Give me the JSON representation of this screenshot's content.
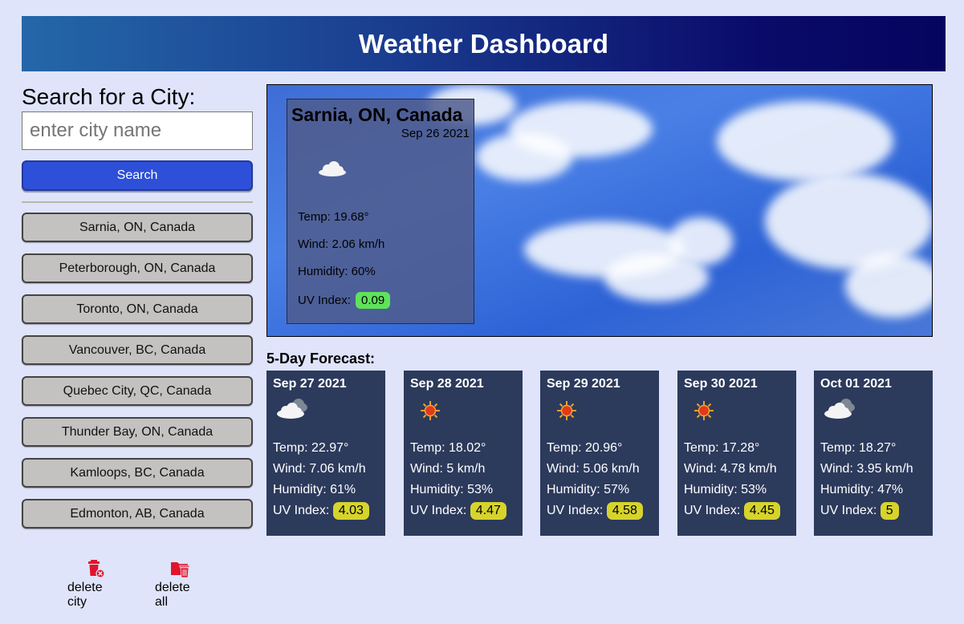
{
  "header": {
    "title": "Weather Dashboard"
  },
  "search": {
    "label": "Search for a City:",
    "placeholder": "enter city name",
    "button_label": "Search"
  },
  "history": [
    "Sarnia, ON, Canada",
    "Peterborough, ON, Canada",
    "Toronto, ON, Canada",
    "Vancouver, BC, Canada",
    "Quebec City, QC, Canada",
    "Thunder Bay, ON, Canada",
    "Kamloops, BC, Canada",
    "Edmonton, AB, Canada"
  ],
  "actions": {
    "delete_city": "delete city",
    "delete_all": "delete all"
  },
  "current": {
    "city": "Sarnia, ON, Canada",
    "date": "Sep 26 2021",
    "icon": "cloud-icon",
    "temp": "Temp: 19.68°",
    "wind": "Wind: 2.06 km/h",
    "humidity": "Humidity: 60%",
    "uv_label": "UV Index:",
    "uv_value": "0.09",
    "uv_color": "#5ee35a"
  },
  "forecast": {
    "title": "5-Day Forecast:",
    "days": [
      {
        "date": "Sep 27 2021",
        "icon": "cloudy-icon",
        "temp": "Temp: 22.97°",
        "wind": "Wind: 7.06 km/h",
        "humidity": "Humidity: 61%",
        "uv_label": "UV Index:",
        "uv": "4.03",
        "uv_color": "#d6d42c"
      },
      {
        "date": "Sep 28 2021",
        "icon": "sun-icon",
        "temp": "Temp: 18.02°",
        "wind": "Wind: 5 km/h",
        "humidity": "Humidity: 53%",
        "uv_label": "UV Index:",
        "uv": "4.47",
        "uv_color": "#d6d42c"
      },
      {
        "date": "Sep 29 2021",
        "icon": "sun-icon",
        "temp": "Temp: 20.96°",
        "wind": "Wind: 5.06 km/h",
        "humidity": "Humidity: 57%",
        "uv_label": "UV Index:",
        "uv": "4.58",
        "uv_color": "#d6d42c"
      },
      {
        "date": "Sep 30 2021",
        "icon": "sun-icon",
        "temp": "Temp: 17.28°",
        "wind": "Wind: 4.78 km/h",
        "humidity": "Humidity: 53%",
        "uv_label": "UV Index:",
        "uv": "4.45",
        "uv_color": "#d6d42c"
      },
      {
        "date": "Oct 01 2021",
        "icon": "cloudy-icon",
        "temp": "Temp: 18.27°",
        "wind": "Wind: 3.95 km/h",
        "humidity": "Humidity: 47%",
        "uv_label": "UV Index:",
        "uv": "5",
        "uv_color": "#d6d42c"
      }
    ]
  },
  "colors": {
    "header_start": "#2467a8",
    "header_end": "#05045e",
    "search_button": "#2e4fd8",
    "forecast_card": "#2c3a5c",
    "delete_icon": "#e0142c"
  }
}
